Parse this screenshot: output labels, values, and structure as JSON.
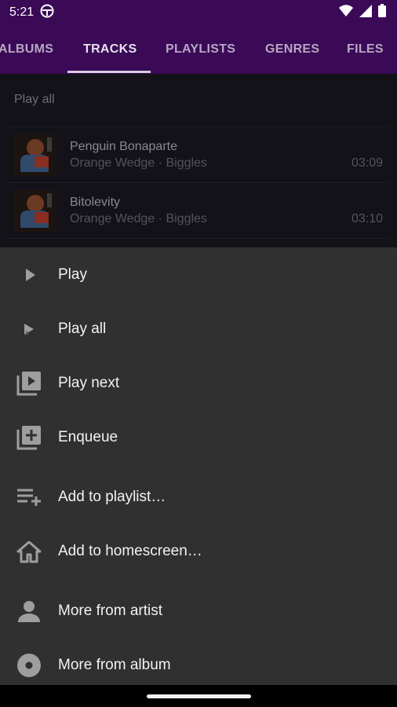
{
  "status": {
    "time": "5:21"
  },
  "tabs": [
    {
      "label": "ALBUMS"
    },
    {
      "label": "TRACKS"
    },
    {
      "label": "PLAYLISTS"
    },
    {
      "label": "GENRES"
    },
    {
      "label": "FILES"
    }
  ],
  "list": {
    "play_all": "Play all",
    "tracks": [
      {
        "title": "Penguin Bonaparte",
        "subtitle": "Orange Wedge · Biggles",
        "duration": "03:09"
      },
      {
        "title": "Bitolevity",
        "subtitle": "Orange Wedge · Biggles",
        "duration": "03:10"
      }
    ]
  },
  "menu": {
    "items": [
      {
        "label": "Play",
        "icon": "play-icon"
      },
      {
        "label": "Play all",
        "icon": "play-all-icon"
      },
      {
        "label": "Play next",
        "icon": "play-next-icon"
      },
      {
        "label": "Enqueue",
        "icon": "enqueue-icon"
      },
      {
        "label": "Add to playlist…",
        "icon": "playlist-add-icon"
      },
      {
        "label": "Add to homescreen…",
        "icon": "home-icon"
      },
      {
        "label": "More from artist",
        "icon": "person-icon"
      },
      {
        "label": "More from album",
        "icon": "album-icon"
      }
    ]
  },
  "colors": {
    "appbar": "#3a0a57",
    "sheet": "#303030"
  }
}
